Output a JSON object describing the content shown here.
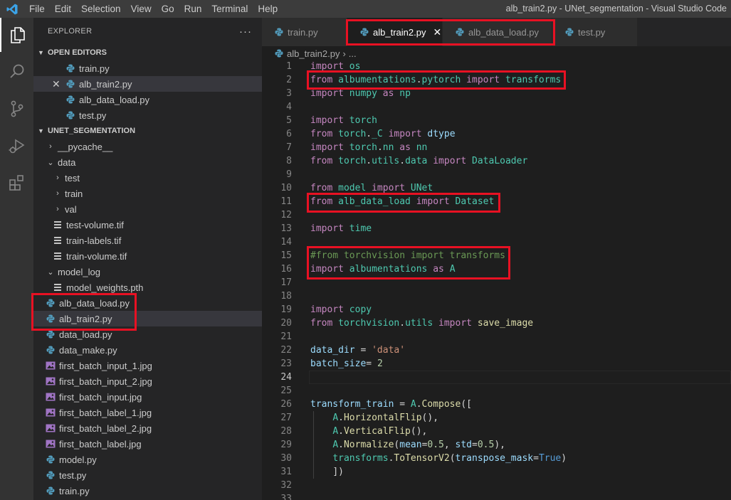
{
  "window_title": "alb_train2.py - UNet_segmentation - Visual Studio Code",
  "menu": [
    "File",
    "Edit",
    "Selection",
    "View",
    "Go",
    "Run",
    "Terminal",
    "Help"
  ],
  "explorer": {
    "title": "EXPLORER",
    "more": "···",
    "open_editors_label": "OPEN EDITORS",
    "open_editors": [
      "train.py",
      "alb_train2.py",
      "alb_data_load.py",
      "test.py"
    ],
    "project_label": "UNET_SEGMENTATION",
    "tree": [
      {
        "name": "__pycache__"
      },
      {
        "name": "data"
      },
      {
        "name": "test"
      },
      {
        "name": "train"
      },
      {
        "name": "val"
      },
      {
        "name": "test-volume.tif"
      },
      {
        "name": "train-labels.tif"
      },
      {
        "name": "train-volume.tif"
      },
      {
        "name": "model_log"
      },
      {
        "name": "model_weights.pth"
      },
      {
        "name": "alb_data_load.py"
      },
      {
        "name": "alb_train2.py"
      },
      {
        "name": "data_load.py"
      },
      {
        "name": "data_make.py"
      },
      {
        "name": "first_batch_input_1.jpg"
      },
      {
        "name": "first_batch_input_2.jpg"
      },
      {
        "name": "first_batch_input.jpg"
      },
      {
        "name": "first_batch_label_1.jpg"
      },
      {
        "name": "first_batch_label_2.jpg"
      },
      {
        "name": "first_batch_label.jpg"
      },
      {
        "name": "model.py"
      },
      {
        "name": "test.py"
      },
      {
        "name": "train.py"
      }
    ]
  },
  "tabs": [
    {
      "label": "train.py",
      "active": false
    },
    {
      "label": "alb_train2.py",
      "active": true,
      "close": "✕"
    },
    {
      "label": "alb_data_load.py",
      "active": false
    },
    {
      "label": "test.py",
      "active": false
    }
  ],
  "breadcrumb": {
    "file": "alb_train2.py",
    "sep": "›",
    "rest": "..."
  },
  "editor": {
    "current_line": 24,
    "lines": [
      {
        "n": "1",
        "text": "import os"
      },
      {
        "n": "2",
        "text": "from albumentations.pytorch import transforms"
      },
      {
        "n": "3",
        "text": "import numpy as np"
      },
      {
        "n": "4",
        "text": ""
      },
      {
        "n": "5",
        "text": "import torch"
      },
      {
        "n": "6",
        "text": "from torch._C import dtype"
      },
      {
        "n": "7",
        "text": "import torch.nn as nn"
      },
      {
        "n": "8",
        "text": "from torch.utils.data import DataLoader"
      },
      {
        "n": "9",
        "text": ""
      },
      {
        "n": "10",
        "text": "from model import UNet"
      },
      {
        "n": "11",
        "text": "from alb_data_load import Dataset"
      },
      {
        "n": "12",
        "text": ""
      },
      {
        "n": "13",
        "text": "import time"
      },
      {
        "n": "14",
        "text": ""
      },
      {
        "n": "15",
        "text": "#from torchvision import transforms"
      },
      {
        "n": "16",
        "text": "import albumentations as A"
      },
      {
        "n": "17",
        "text": ""
      },
      {
        "n": "18",
        "text": ""
      },
      {
        "n": "19",
        "text": "import copy"
      },
      {
        "n": "20",
        "text": "from torchvision.utils import save_image"
      },
      {
        "n": "21",
        "text": ""
      },
      {
        "n": "22",
        "text": "data_dir = 'data'"
      },
      {
        "n": "23",
        "text": "batch_size= 2"
      },
      {
        "n": "24",
        "text": ""
      },
      {
        "n": "25",
        "text": ""
      },
      {
        "n": "26",
        "text": "transform_train = A.Compose(["
      },
      {
        "n": "27",
        "text": "    A.HorizontalFlip(),"
      },
      {
        "n": "28",
        "text": "    A.VerticalFlip(),"
      },
      {
        "n": "29",
        "text": "    A.Normalize(mean=0.5, std=0.5),"
      },
      {
        "n": "30",
        "text": "    transforms.ToTensorV2(transpose_mask=True)"
      },
      {
        "n": "31",
        "text": "    ])"
      },
      {
        "n": "32",
        "text": ""
      },
      {
        "n": "33",
        "text": ""
      }
    ]
  },
  "colors": {
    "annotation_red": "#e81123",
    "keyword": "#c586c0",
    "module": "#4ec9b0",
    "variable": "#9cdcfe",
    "function": "#dcdcaa",
    "string": "#ce9178",
    "number": "#b5cea8",
    "comment": "#6a9955",
    "constant": "#569cd6",
    "python_icon": "#519aba",
    "image_icon": "#a074c4"
  },
  "icons": {
    "explorer": "files-icon",
    "search": "search-icon",
    "scm": "source-control-icon",
    "debug": "run-debug-icon",
    "extensions": "extensions-icon"
  }
}
